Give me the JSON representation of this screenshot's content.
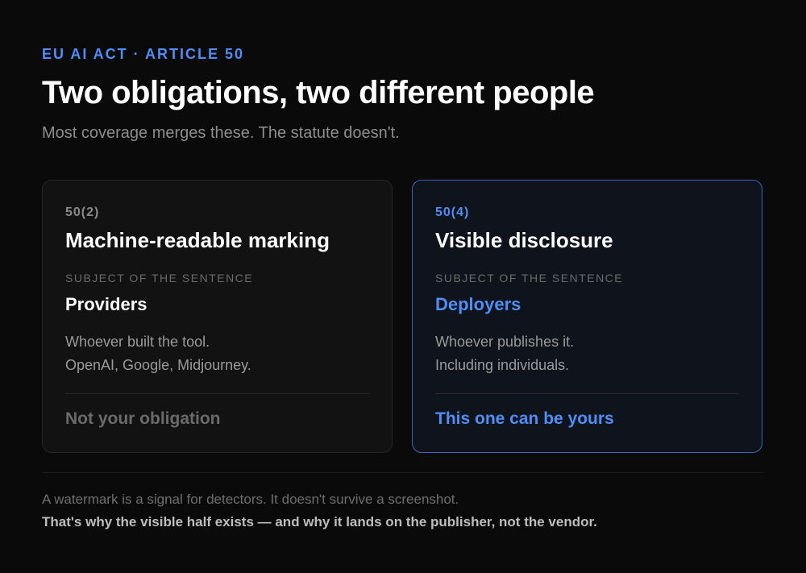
{
  "header": {
    "eyebrow": "EU AI ACT · ARTICLE 50",
    "title": "Two obligations, two different people",
    "subtitle": "Most coverage merges these. The statute doesn't."
  },
  "cards": [
    {
      "code": "50(2)",
      "title": "Machine-readable marking",
      "sublabel": "SUBJECT OF THE SENTENCE",
      "subject": "Providers",
      "desc_lines": [
        "Whoever built the tool.",
        "OpenAI, Google, Midjourney."
      ],
      "footer": "Not your obligation"
    },
    {
      "code": "50(4)",
      "title": "Visible disclosure",
      "sublabel": "SUBJECT OF THE SENTENCE",
      "subject": "Deployers",
      "desc_lines": [
        "Whoever publishes it.",
        "Including individuals."
      ],
      "footer": "This one can be yours"
    }
  ],
  "footnote": {
    "line1": "A watermark is a signal for detectors. It doesn't survive a screenshot.",
    "line2": "That's why the visible half exists — and why it lands on the publisher, not the vendor."
  },
  "colors": {
    "background": "#0a0a0a",
    "accent": "#4f8ef7",
    "card_left_bg": "#121212",
    "card_right_bg": "#0f131c",
    "card_right_border": "#3a66b8"
  }
}
